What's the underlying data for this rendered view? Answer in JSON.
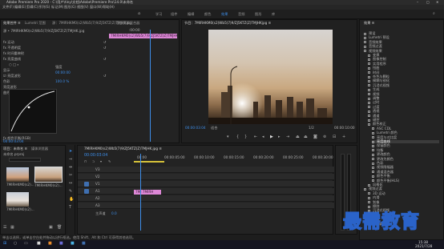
{
  "titlebar": {
    "text": "Adobe Premiere Pro 2020 - C:\\用户\\tiny\\文档\\Adobe\\Premiere Pro\\14.0\\未命名"
  },
  "menu": [
    "文件(F)",
    "编辑(E)",
    "剪辑(C)",
    "序列(S)",
    "标记(M)",
    "图形(G)",
    "视图(V)",
    "窗口(W)",
    "帮助(H)"
  ],
  "workspaces": [
    "学习",
    "组件",
    "编辑",
    "颜色",
    "效果",
    "音频",
    "图形",
    "库"
  ],
  "workspace_active": "效果",
  "effect_controls": {
    "tabs": [
      "效果控件 ≡",
      "Lumetri 范围",
      "源：7MIRHKM0(s2)Wb5(7)9/ZJ5KTZ(Z)TMJHKjpg",
      "音频剪辑混合器"
    ],
    "source_label": "源 • 7MIRHKM0(s2)Wb5(7)9/ZJ5KTZ(Z)TMJHK.jpg",
    "timecode_top": ":00:00",
    "clip_label": "7MIRHKM0(s2)Wb5(7)9/ZJ5KTZ(Z)TMJHKjpg",
    "rows": [
      "fx 运动",
      "fx 不透明度",
      "fx 时间重映射",
      "fx 亮度曲线",
      "○ □ ⌕",
      "   显示",
      "   ☑ 亮度波形",
      "   色彩",
      "   亮度波形",
      "   曲线",
      "ƒx 颜色平衡(RGB)",
      "fx 颜色替换(RGB)"
    ],
    "values": [
      "强度",
      "100.0 %",
      "00:00:00"
    ],
    "timecode_bottom": "00:00:03:04"
  },
  "program": {
    "tab": "节目：7MIRHKM0(s2)Wb5(7)9/ZJ5KTZ(Z)TMJHKjpg ≡",
    "timecode_left": "00:00:03:04",
    "fit": "适合",
    "quality": "1/2",
    "timecode_right": "00:00:10:00"
  },
  "project": {
    "tabs": [
      "项目：未命名 ≡",
      "媒体浏览器"
    ],
    "path": "未命名.prproj",
    "search_placeholder": "",
    "items": [
      {
        "name": "7MIRHKM0(s2)...",
        "duration": "5:00"
      },
      {
        "name": "7MIRHKM0(s2)...",
        "duration": "5:00"
      },
      {
        "name": "7MIRHKM0(s2)...",
        "duration": "5:00"
      }
    ]
  },
  "timeline": {
    "tab": "7MIRHKM0(s2)Wb5(7)9/ZJ5KTZ(Z)TMJHK.jpg ≡",
    "timecode": "00:00:03:04",
    "ruler": [
      "00:00",
      "00:00:05:00",
      "00:00:10:00",
      "00:00:15:00",
      "00:00:20:00",
      "00:00:25:00",
      "00:00:30:00"
    ],
    "tracks": [
      "V3",
      "V2",
      "V1",
      "A1",
      "A2",
      "A3"
    ],
    "mix_label": "主声道",
    "mix_value": "0.0",
    "clip_label": "7MI 7MIRH"
  },
  "effects": {
    "tab": "效果 ≡",
    "items": [
      "预设",
      "Lumetri 预设",
      "音频效果",
      "音频过渡",
      "视频效果",
      "变换",
      "图像控制",
      "实用程序",
      "扭曲",
      "时间",
      "杂色与颗粒",
      "模糊与锐化",
      "沉浸式视频",
      "生成",
      "视频",
      "调整",
      "过时",
      "过渡",
      "透视",
      "通道",
      "键控",
      "颜色校正",
      "ASC CDL",
      "Lumetri 颜色",
      "亮度与对比度",
      "亮度曲线",
      "保留颜色",
      "均衡",
      "更改颜色",
      "更改为颜色",
      "色彩",
      "视频限幅器",
      "通道混合器",
      "颜色平衡",
      "颜色平衡(HLS)",
      "风格化",
      "视频过渡",
      "3D 运动",
      "内滑",
      "划像",
      "擦除",
      "沉浸式视频",
      "溶解",
      "缩放",
      "页面剥落"
    ],
    "selected": "亮度曲线"
  },
  "status": "单击以选择，或单击空白处并拖动以进行框选。使用 Shift、Alt 和 Ctrl 可获得其他选项。",
  "taskbar": {
    "time": "15:38",
    "date": "2021/7/28"
  },
  "watermark": "最需教育",
  "colors": {
    "accent": "#3d8de8",
    "clip_pink": "#dd87d6",
    "panel": "#232323",
    "background": "#1d1d1d"
  }
}
